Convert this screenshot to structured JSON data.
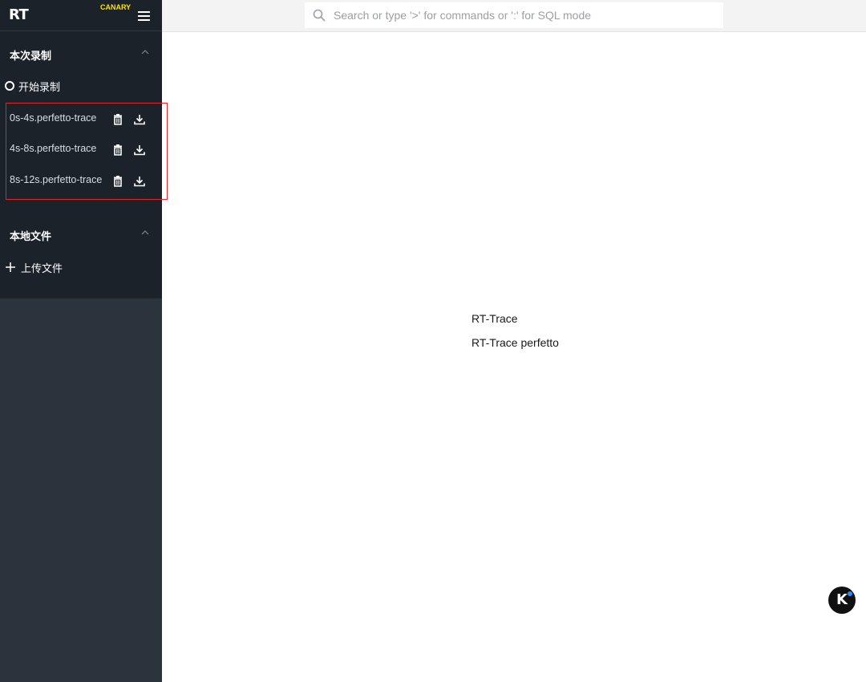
{
  "app": {
    "logo": "RT",
    "channel_badge": "CANARY"
  },
  "search": {
    "placeholder": "Search or type '>' for commands or ':' for SQL mode",
    "value": ""
  },
  "sidebar": {
    "recording_section": {
      "title": "本次录制",
      "start_label": "开始录制",
      "files": [
        {
          "name": "0s-4s.perfetto-trace"
        },
        {
          "name": "4s-8s.perfetto-trace"
        },
        {
          "name": "8s-12s.perfetto-trace"
        }
      ]
    },
    "local_section": {
      "title": "本地文件",
      "upload_label": "上传文件"
    }
  },
  "main": {
    "line1": "RT-Trace",
    "line2": "RT-Trace perfetto"
  },
  "floating_badge": {
    "letter": "K"
  },
  "colors": {
    "sidebar_bg": "#2b333c",
    "sidebar_panel_bg": "#1b2229",
    "canary_yellow": "#ffe100",
    "highlight_red": "#e0262c"
  }
}
